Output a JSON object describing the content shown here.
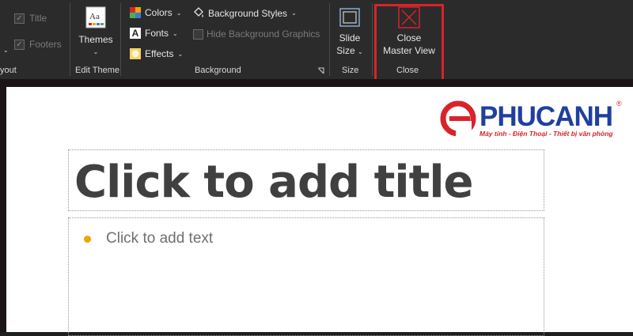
{
  "ribbon": {
    "master_layout": {
      "title_label": "Title",
      "footers_label": "Footers",
      "group_label": "yout"
    },
    "edit_theme": {
      "themes_label": "Themes",
      "group_label": "Edit Theme"
    },
    "background": {
      "colors_label": "Colors",
      "fonts_label": "Fonts",
      "effects_label": "Effects",
      "background_styles_label": "Background Styles",
      "hide_background_graphics_label": "Hide Background Graphics",
      "group_label": "Background"
    },
    "size": {
      "slide_size_line1": "Slide",
      "slide_size_line2": "Size",
      "group_label": "Size"
    },
    "close": {
      "close_line1": "Close",
      "close_line2": "Master View",
      "group_label": "Close"
    },
    "colors": {
      "highlight": "#d8232a",
      "ribbon_bg": "#2b2b2b"
    }
  },
  "slide": {
    "title_placeholder": "Click to add title",
    "body_placeholder": "Click to add text",
    "bullet_color": "#f0a500"
  },
  "logo": {
    "name": "PHUCANH",
    "registered": "®",
    "tagline": "Máy tính - Điện Thoại - Thiết bị văn phòng",
    "colors": {
      "red": "#d8232a",
      "blue": "#1f3fa0"
    }
  }
}
